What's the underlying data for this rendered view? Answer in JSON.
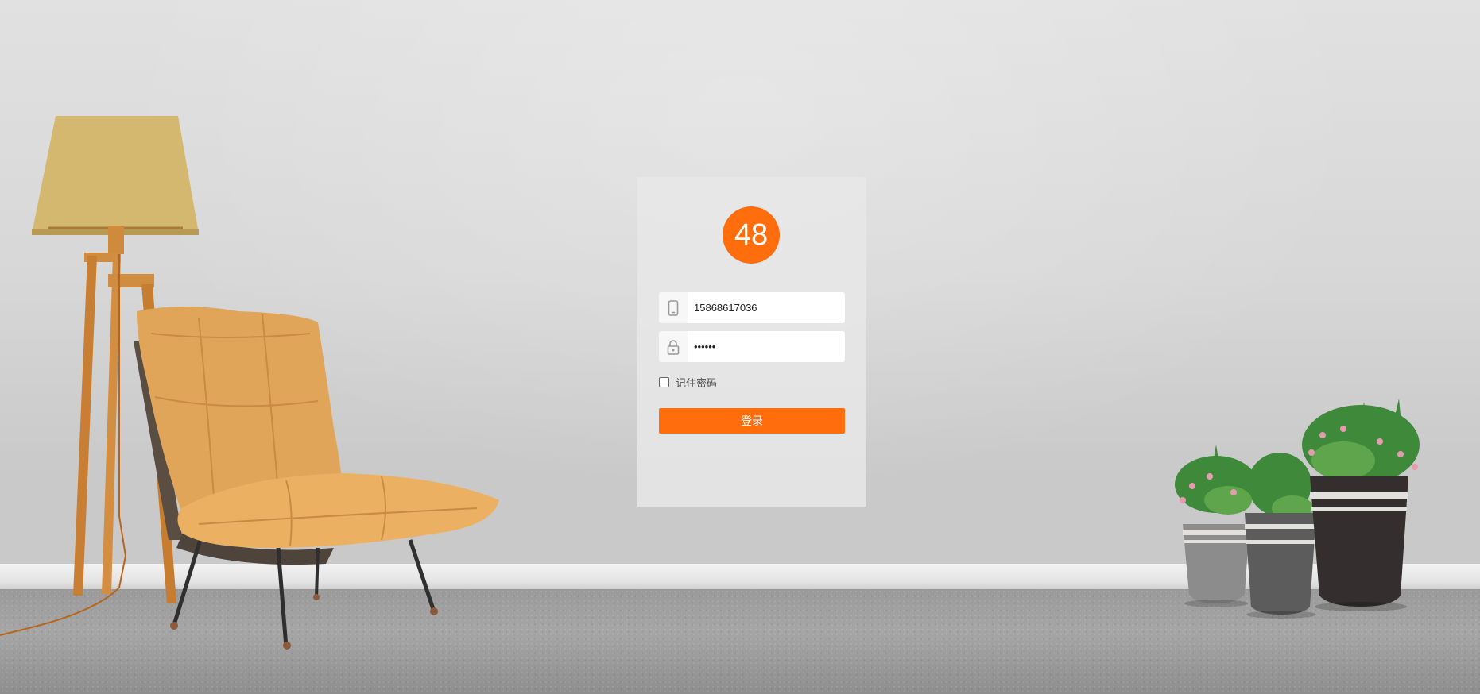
{
  "login": {
    "logo_text": "48",
    "phone": {
      "value": "15868617036",
      "icon": "phone-icon"
    },
    "password": {
      "value": "111111",
      "icon": "lock-icon"
    },
    "remember": {
      "label": "记住密码",
      "checked": false
    },
    "submit_label": "登录"
  },
  "colors": {
    "accent": "#ff6d0c",
    "panel": "#e8e8e8",
    "wall": "#d9d9d9",
    "floor": "#9a9a9a"
  }
}
